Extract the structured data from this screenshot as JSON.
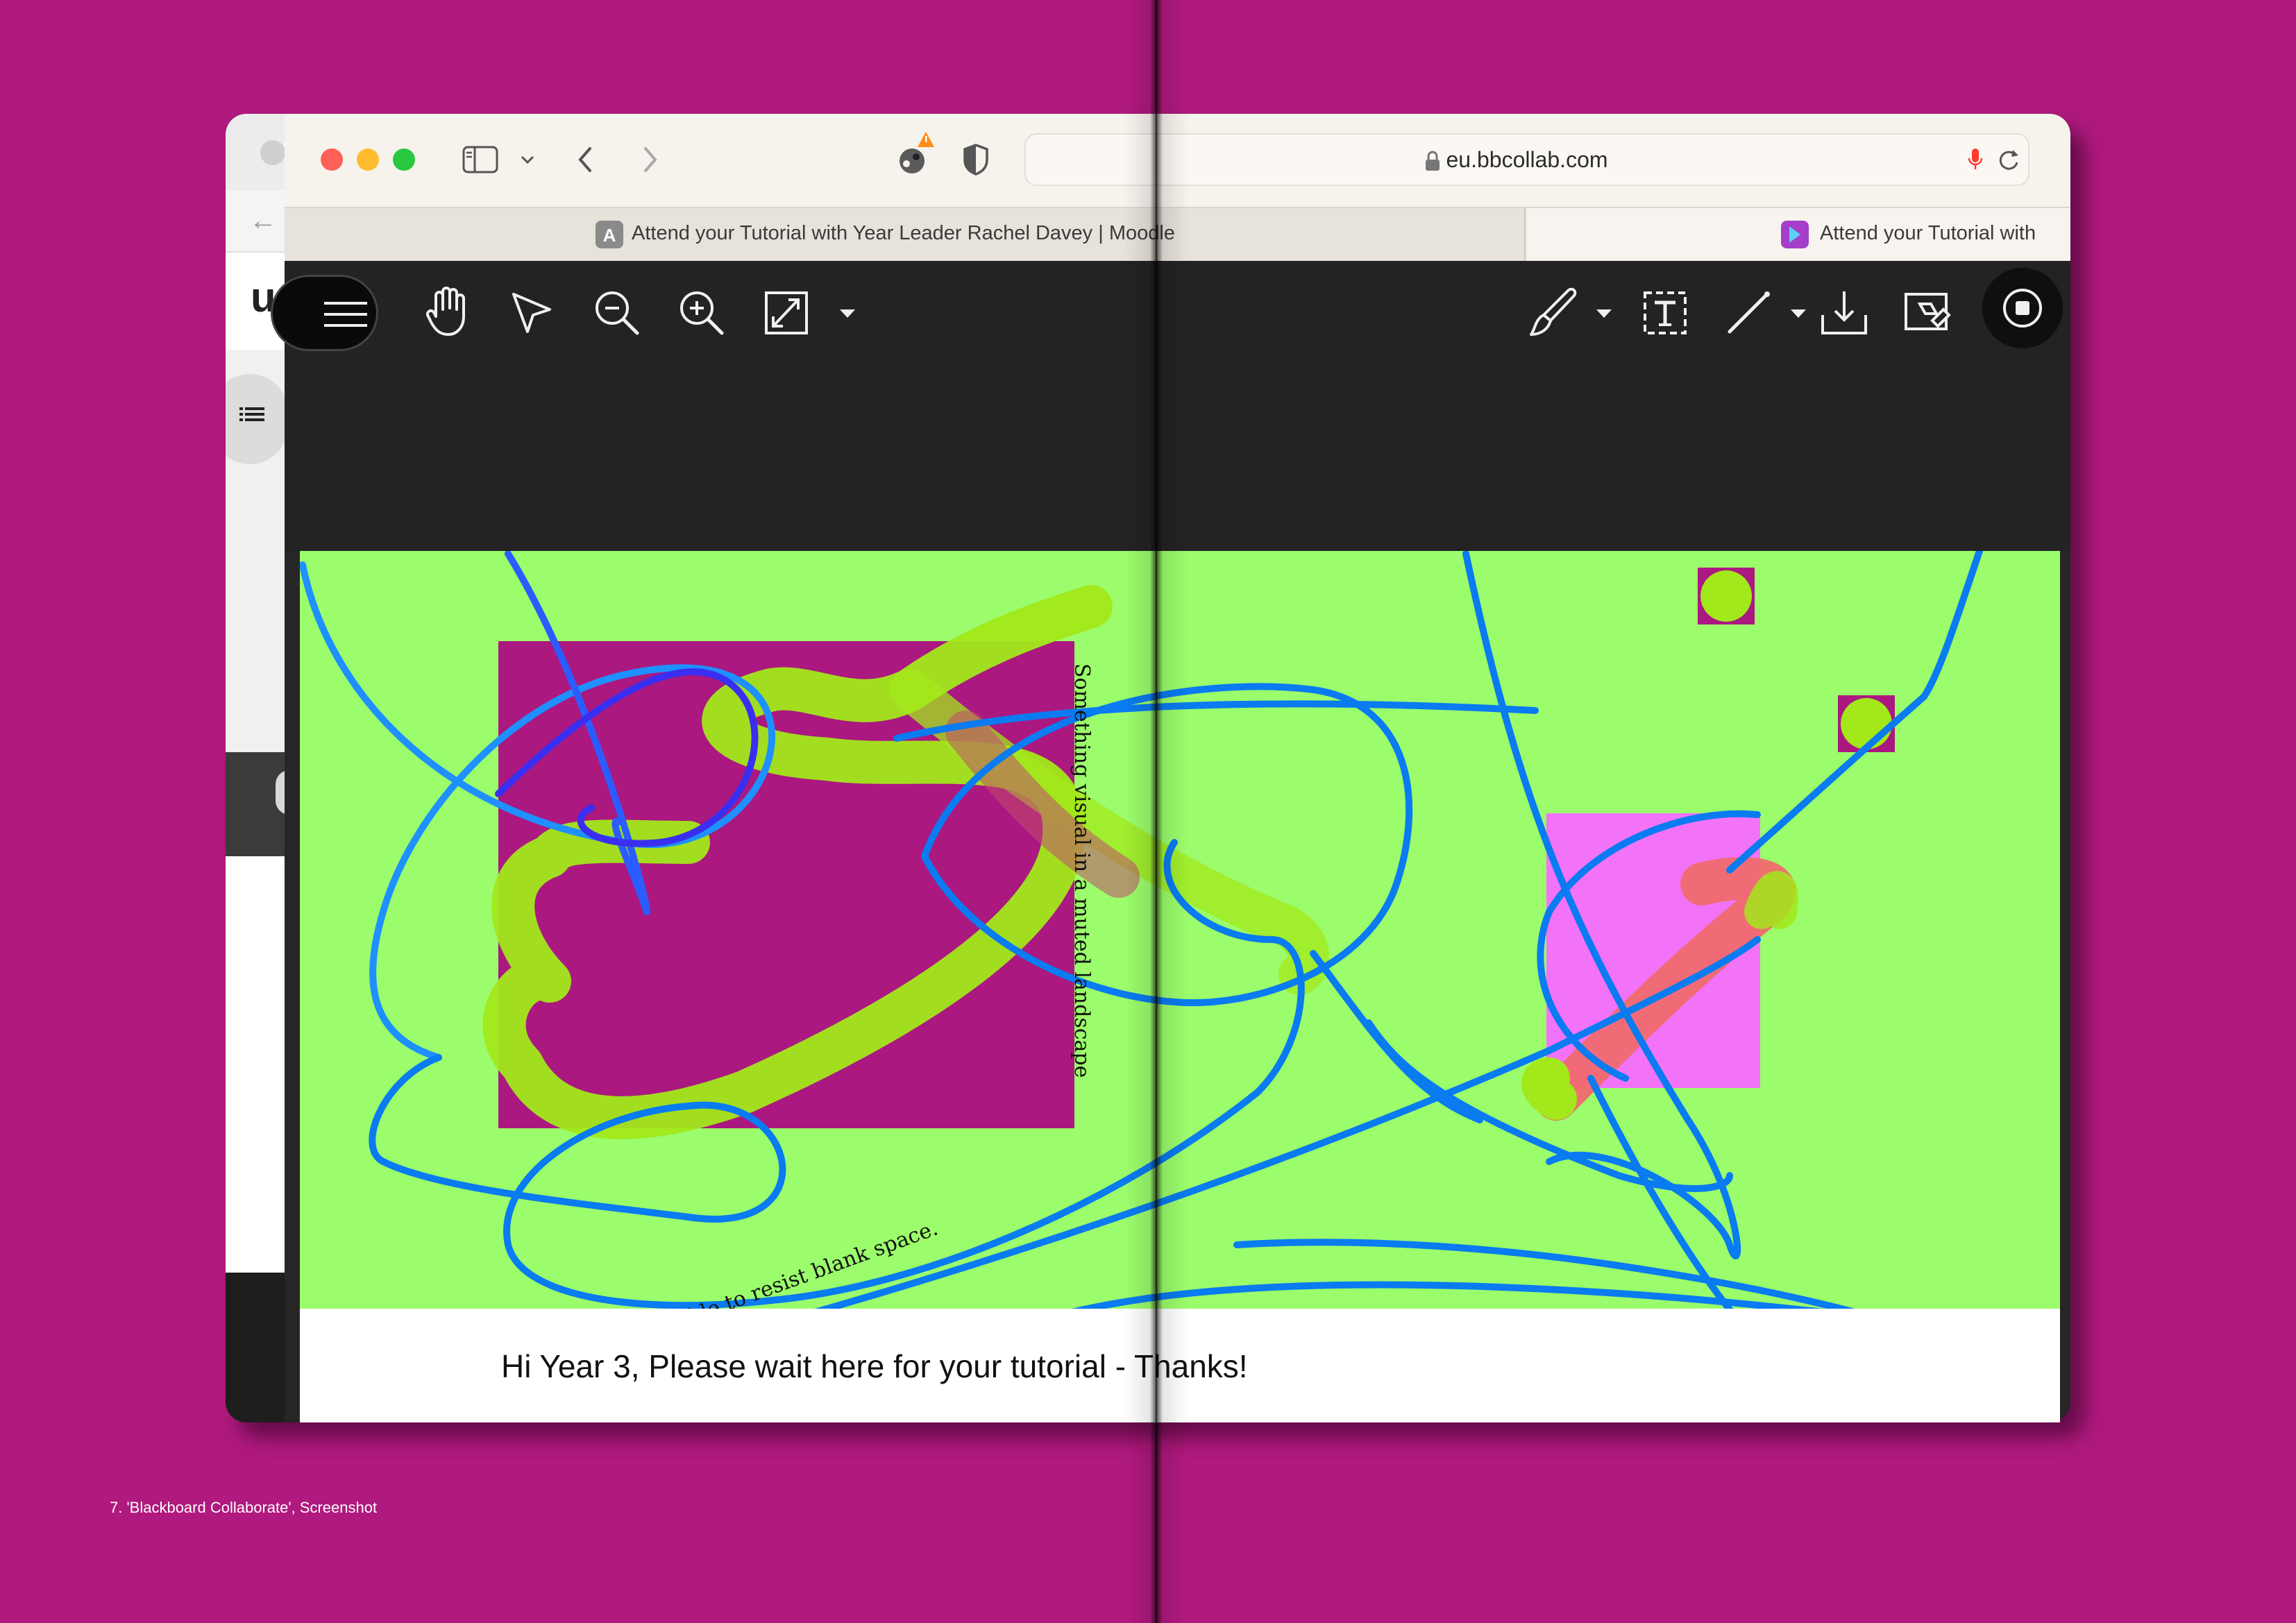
{
  "browser": {
    "url": "eu.bbcollab.com",
    "tabs": [
      {
        "label": "Attend your Tutorial with Year Leader Rachel Davey | Moodle",
        "favicon_letter": "A",
        "active": true
      },
      {
        "label": "Attend your Tutorial with",
        "active": false
      }
    ]
  },
  "background_window": {
    "logo_fragment": "ua"
  },
  "toolbar": {
    "left_tools": [
      "menu-icon",
      "hand-pan-icon",
      "pointer-select-icon",
      "zoom-out-icon",
      "zoom-in-icon",
      "fit-to-screen-icon",
      "chevron-down-icon"
    ],
    "right_tools": [
      "pen-brush-icon",
      "chevron-down-icon",
      "text-tool-icon",
      "line-tool-icon",
      "chevron-down-icon",
      "download-icon",
      "eraser-icon",
      "stop-share-icon"
    ]
  },
  "whiteboard": {
    "footer_message": "Hi Year 3, Please wait here for your tutorial - Thanks!",
    "annotation_vertical": "Something visual in a muted landscape",
    "annotation_diagonal": "Patiently waiting lines, unable to resist blank space."
  },
  "caption": "7. 'Blackboard Collaborate', Screenshot",
  "colors": {
    "page_background": "#b0197e",
    "board_green": "#9bfd6b",
    "stroke_blue": "#0a7bf0",
    "highlighter_lime": "#a2e81a",
    "rect_magenta": "#ab1880",
    "rect_pink": "#f273f8"
  }
}
